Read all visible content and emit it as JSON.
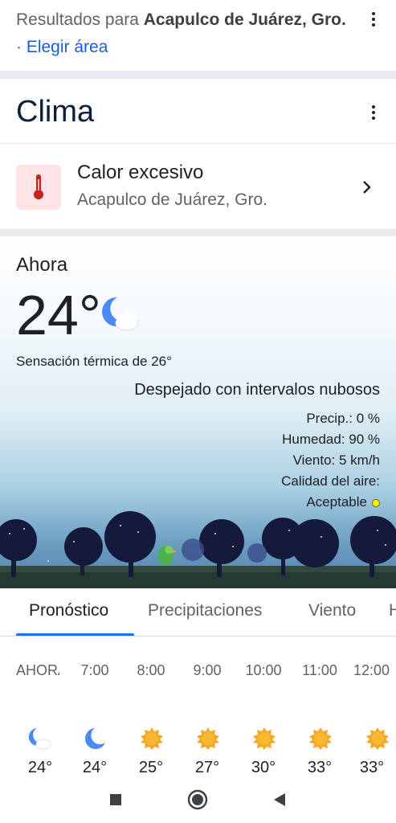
{
  "header": {
    "results_prefix": "Resultados para ",
    "location_bold": "Acapulco de Juárez, Gro.",
    "separator": " · ",
    "choose_area_link": "Elegir área"
  },
  "weather_card": {
    "title": "Clima",
    "alert": {
      "title": "Calor excesivo",
      "location": "Acapulco de Juárez, Gro."
    },
    "now": {
      "label": "Ahora",
      "temperature": "24°",
      "feels_like": "Sensación térmica de 26°",
      "condition": "Despejado con intervalos nubosos",
      "precip": "Precip.: 0 %",
      "humidity": "Humedad: 90 %",
      "wind": "Viento: 5 km/h",
      "air_quality_label": "Calidad del aire:",
      "air_quality_value": "Aceptable",
      "icon": "moon-cloud-icon"
    },
    "tabs": [
      {
        "label": "Pronóstico",
        "active": true
      },
      {
        "label": "Precipitaciones",
        "active": false
      },
      {
        "label": "Viento",
        "active": false
      },
      {
        "label": "H",
        "active": false
      }
    ],
    "hourly": [
      {
        "time": "AHORA",
        "temp": "24°",
        "icon": "moon-cloud-icon"
      },
      {
        "time": "7:00",
        "temp": "24°",
        "icon": "moon-icon"
      },
      {
        "time": "8:00",
        "temp": "25°",
        "icon": "sun-icon"
      },
      {
        "time": "9:00",
        "temp": "27°",
        "icon": "sun-icon"
      },
      {
        "time": "10:00",
        "temp": "30°",
        "icon": "sun-icon"
      },
      {
        "time": "11:00",
        "temp": "33°",
        "icon": "sun-icon"
      },
      {
        "time": "12:00",
        "temp": "33°",
        "icon": "sun-icon"
      }
    ]
  },
  "colors": {
    "link": "#1a5fd0",
    "tab_active": "#1a73e8",
    "alert_bg": "#fbe4e3",
    "thermometer": "#c5221f",
    "sun": "#f5a623",
    "moon": "#4a8af4",
    "air_quality_dot": "#ffee00"
  },
  "nav": {
    "recents": "square-icon",
    "home": "circle-icon",
    "back": "triangle-back-icon"
  }
}
